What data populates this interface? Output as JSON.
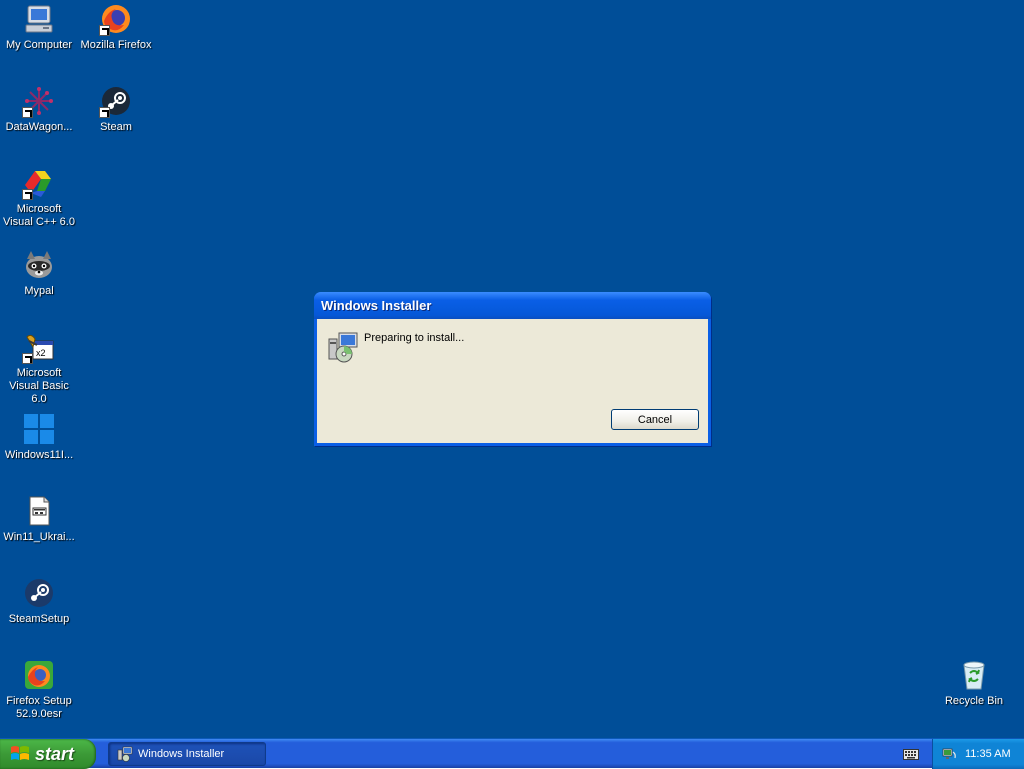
{
  "desktop": {
    "background_color": "#004e98",
    "icons": [
      {
        "label": "My Computer",
        "icon": "my-computer-icon"
      },
      {
        "label": "Mozilla Firefox",
        "icon": "firefox-icon"
      },
      {
        "label": "DataWagon...",
        "icon": "datawagon-icon"
      },
      {
        "label": "Steam",
        "icon": "steam-icon"
      },
      {
        "label": "Microsoft Visual C++ 6.0",
        "icon": "visual-cpp-icon"
      },
      {
        "label": "Mypal",
        "icon": "mypal-icon"
      },
      {
        "label": "Microsoft Visual Basic 6.0",
        "icon": "visual-basic-icon"
      },
      {
        "label": "Windows11I...",
        "icon": "windows11-icon"
      },
      {
        "label": "Win11_Ukrai...",
        "icon": "document-icon"
      },
      {
        "label": "SteamSetup",
        "icon": "steam-setup-icon"
      },
      {
        "label": "Firefox Setup 52.9.0esr",
        "icon": "firefox-setup-icon"
      },
      {
        "label": "Recycle Bin",
        "icon": "recycle-bin-icon"
      }
    ]
  },
  "dialog": {
    "title": "Windows Installer",
    "message": "Preparing to install...",
    "cancel_label": "Cancel",
    "icon": "installer-icon"
  },
  "taskbar": {
    "start_label": "start",
    "task_button_label": "Windows Installer",
    "clock": "11:35 AM"
  }
}
